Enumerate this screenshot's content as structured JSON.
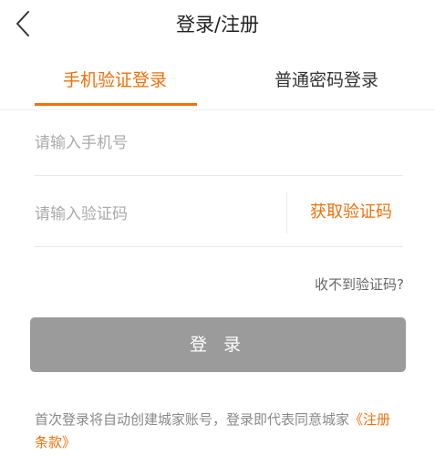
{
  "header": {
    "title": "登录/注册",
    "back_icon": "chevron-left-icon"
  },
  "tabs": [
    {
      "label": "手机验证登录",
      "active": true
    },
    {
      "label": "普通密码登录",
      "active": false
    }
  ],
  "form": {
    "phone_placeholder": "请输入手机号",
    "phone_value": "",
    "code_placeholder": "请输入验证码",
    "code_value": "",
    "get_code_label": "获取验证码",
    "no_code_label": "收不到验证码?",
    "login_label": "登 录"
  },
  "agreement": {
    "text": "首次登录将自动创建城家账号，登录即代表同意城家",
    "terms_label": "《注册条款》"
  },
  "colors": {
    "accent": "#f0700a",
    "login_button": "#9b9b9b",
    "text_primary": "#222222",
    "text_secondary": "#888888"
  }
}
